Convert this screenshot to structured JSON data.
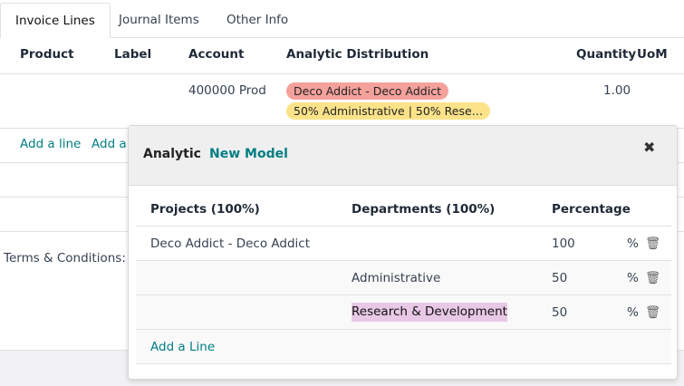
{
  "tabs": [
    "Invoice Lines",
    "Journal Items",
    "Other Info"
  ],
  "columns": {
    "product": "Product",
    "label": "Label",
    "account": "Account",
    "analytic": "Analytic Distribution",
    "quantity": "Quantity",
    "uom": "UoM"
  },
  "line": {
    "account": "400000 Prod",
    "tags": [
      {
        "text": "Deco Addict - Deco Addict",
        "color": "#f4a19c"
      },
      {
        "text": "50% Administrative | 50% Rese…",
        "color": "#fce38a"
      }
    ],
    "quantity": "1.00"
  },
  "actions": {
    "add_line": "Add a line",
    "add_other": "Add a"
  },
  "terms": "Terms & Conditions: h",
  "popup": {
    "title": "Analytic",
    "new_model": "New Model",
    "close_icon": "close-icon",
    "headers": {
      "projects": "Projects (100%)",
      "departments": "Departments (100%)",
      "percentage": "Percentage"
    },
    "rows": [
      {
        "project": "Deco Addict - Deco Addict",
        "department": "",
        "percentage": "100",
        "unit": "%"
      },
      {
        "project": "",
        "department": "Administrative",
        "percentage": "50",
        "unit": "%"
      },
      {
        "project": "",
        "department": "Research & Development",
        "percentage": "50",
        "unit": "%"
      }
    ],
    "add_line": "Add a Line"
  },
  "colors": {
    "accent": "#017e84",
    "highlight": "#e8c8e6"
  }
}
